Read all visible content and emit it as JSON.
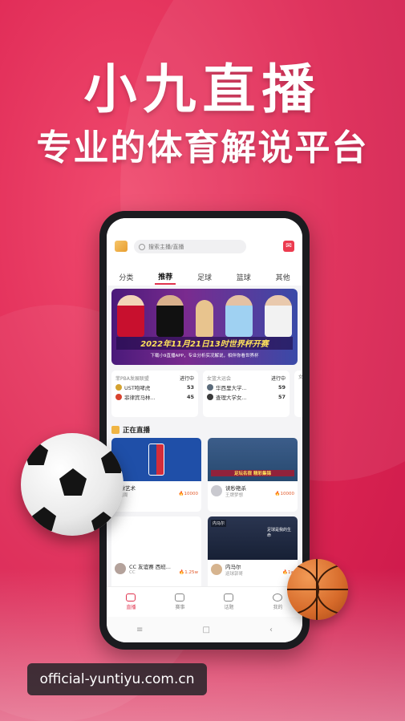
{
  "promo": {
    "headline": "小九直播",
    "tagline": "专业的体育解说平台"
  },
  "app": {
    "search": {
      "placeholder": "搜索主播/直播"
    },
    "tabs": [
      "分类",
      "推荐",
      "足球",
      "篮球",
      "其他"
    ],
    "active_tab": "推荐",
    "banner": {
      "title": "2022年11月21日13时世界杯开赛",
      "subtitle": "下载小9直播APP，专业分析实况解说，相伴你看世界杯"
    },
    "matches": [
      {
        "league": "菲PBA发展联盟",
        "status": "进行中",
        "team1": "UST咆哮虎",
        "score1": "53",
        "team2": "菲律宾马林...",
        "score2": "45"
      },
      {
        "league": "女篮大运会",
        "status": "进行中",
        "team1": "华西里大学...",
        "score1": "59",
        "team2": "查理大学女...",
        "score2": "57"
      }
    ],
    "matches_partial": "女",
    "live_section": {
      "title": "正在直播"
    },
    "live_tiles": [
      {
        "title": "篮球艺术",
        "host": "大周周",
        "heat": "10000",
        "thumb": "nba"
      },
      {
        "title": "读秒艳杀",
        "host": "王牌梦想",
        "heat": "10000",
        "thumb": "soccer",
        "caption": "足坛名宿 精彩集锦"
      },
      {
        "title": "CC 友谊赛 西班...",
        "host": "CC",
        "heat": "1.25w",
        "thumb": "blank"
      },
      {
        "title": "内马尔",
        "host": "巡球郭哥",
        "heat": "1w",
        "thumb": "neymar",
        "tag": "内马尔",
        "quote": "足球是我的生命"
      }
    ],
    "bottom_nav": [
      "直播",
      "赛事",
      "话题",
      "我的"
    ],
    "system_nav": [
      "≡",
      "□",
      "‹"
    ]
  },
  "watermark": {
    "url": "official-yuntiyu.com.cn"
  },
  "colors": {
    "brand": "#e0334e",
    "background": "#e8335a",
    "gold": "#f0b544"
  }
}
